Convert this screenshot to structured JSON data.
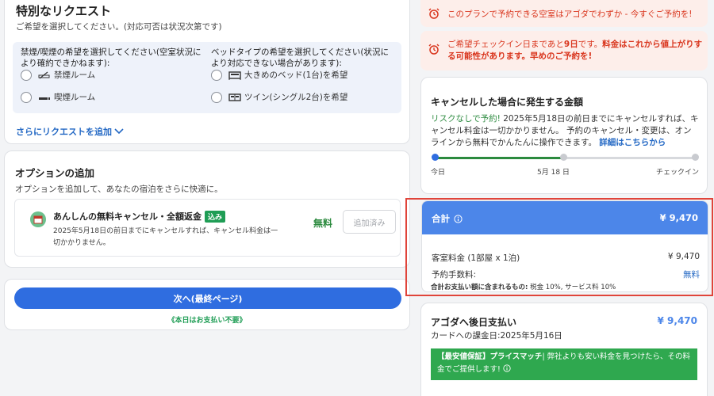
{
  "requests": {
    "title": "特別なリクエスト",
    "subtitle": "ご希望を選択してください。(対応可否は状況次第です)",
    "smoking_group_title": "禁煙/喫煙の希望を選択してください(空室状況により確約できかねます):",
    "smoking_options": [
      "禁煙ルーム",
      "喫煙ルーム"
    ],
    "bed_group_title": "ベッドタイプの希望を選択してください(状況により対応できない場合があります):",
    "bed_options": [
      "大きめのベッド(1台)を希望",
      "ツイン(シングル2台)を希望"
    ],
    "more_link": "さらにリクエストを追加"
  },
  "options": {
    "title": "オプションの追加",
    "subtitle": "オプションを追加して、あなたの宿泊をさらに快適に。",
    "item_name": "あんしんの無料キャンセル・全額返金",
    "item_badge": "込み",
    "item_desc": "2025年5月18日の前日までにキャンセルすれば、キャンセル料金は一切かかりません。",
    "price": "無料",
    "added_button": "追加済み"
  },
  "next": {
    "button": "次へ(最終ページ)",
    "note": "《本日はお支払い不要》"
  },
  "alerts": {
    "alert1": "このプランで予約できる空室はアゴダでわずか - 今すぐご予約を!",
    "alert2_a": "ご希望チェックイン日まであと",
    "alert2_days": "9日",
    "alert2_b": "です。",
    "alert2_c": "料金はこれから値上がりする可能性があります。早めのご予約を!"
  },
  "cancellation": {
    "title": "キャンセルした場合に発生する金額",
    "green_text": "リスクなしで予約!",
    "body": "2025年5月18日の前日までにキャンセルすれば、キャンセル料金は一切かかりません。 予約のキャンセル・変更は、オンラインから無料でかんたんに操作できます。",
    "link": "詳細はこちらから",
    "timeline_labels": [
      "今日",
      "5月 18 日",
      "チェックイン"
    ]
  },
  "total": {
    "label": "合計",
    "amount": "¥ 9,470",
    "room_label": "客室料金 (1部屋 x 1泊)",
    "room_amount": "¥ 9,470",
    "fee_label": "予約手数料:",
    "fee_value": "無料",
    "tax_note_bold": "合計お支払い額に含まれるもの:",
    "tax_note": "税金 10%, サービス料 10%"
  },
  "pay_later": {
    "title": "アゴダへ後日支払い",
    "amount": "¥ 9,470",
    "date": "カードへの課金日:2025年5月16日",
    "promo_bold": "【最安値保証】プライスマッチ",
    "promo_text": "| 弊社よりも安い料金を見つけたら、その料金でご提供します!"
  },
  "colors": {
    "primary_blue": "#2f6de0",
    "total_header": "#4c86e9",
    "green": "#2b8a3e",
    "alert_red": "#d9361e",
    "highlight_border": "#e0443a"
  }
}
